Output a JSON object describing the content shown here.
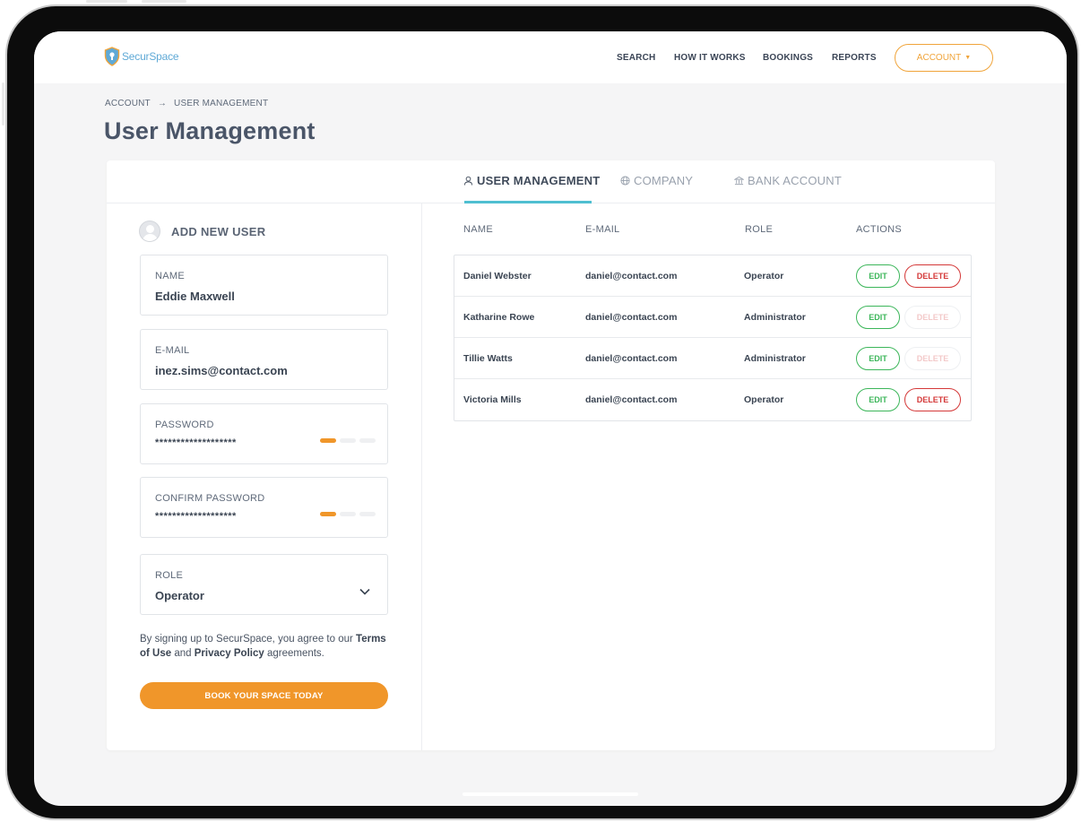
{
  "brand": {
    "name": "SecurSpace"
  },
  "nav": {
    "items": [
      "SEARCH",
      "HOW IT WORKS",
      "BOOKINGS",
      "REPORTS"
    ],
    "account_label": "ACCOUNT"
  },
  "breadcrumb": {
    "parent": "ACCOUNT",
    "current": "USER MANAGEMENT"
  },
  "page_title": "User Management",
  "tabs": [
    {
      "label": "USER MANAGEMENT",
      "icon": "user-icon",
      "active": true
    },
    {
      "label": "COMPANY",
      "icon": "globe-icon",
      "active": false
    },
    {
      "label": "BANK ACCOUNT",
      "icon": "bank-icon",
      "active": false
    }
  ],
  "form": {
    "heading": "ADD NEW USER",
    "name_label": "NAME",
    "name_value": "Eddie Maxwell",
    "email_label": "E-MAIL",
    "email_value": "inez.sims@contact.com",
    "password_label": "PASSWORD",
    "password_value": "*******************",
    "password_strength": 1,
    "confirm_label": "CONFIRM PASSWORD",
    "confirm_value": "*******************",
    "confirm_strength": 1,
    "role_label": "ROLE",
    "role_value": "Operator",
    "terms_prefix": "By signing up to SecurSpace, you agree to our",
    "terms_link": "Terms of Use",
    "terms_and": "and",
    "privacy_link": "Privacy Policy",
    "terms_suffix": "agreements.",
    "cta_label": "BOOK YOUR SPACE TODAY"
  },
  "table": {
    "headers": [
      "NAME",
      "E-MAIL",
      "ROLE",
      "ACTIONS"
    ],
    "edit_label": "EDIT",
    "delete_label": "DELETE",
    "rows": [
      {
        "name": "Daniel Webster",
        "email": "daniel@contact.com",
        "role": "Operator",
        "delete_enabled": true
      },
      {
        "name": "Katharine Rowe",
        "email": "daniel@contact.com",
        "role": "Administrator",
        "delete_enabled": false
      },
      {
        "name": "Tillie Watts",
        "email": "daniel@contact.com",
        "role": "Administrator",
        "delete_enabled": false
      },
      {
        "name": "Victoria Mills",
        "email": "daniel@contact.com",
        "role": "Operator",
        "delete_enabled": true
      }
    ]
  },
  "colors": {
    "accent_orange": "#f0962a",
    "tab_underline": "#4fbfd1",
    "edit_green": "#3cb65a",
    "delete_red": "#d43838"
  }
}
